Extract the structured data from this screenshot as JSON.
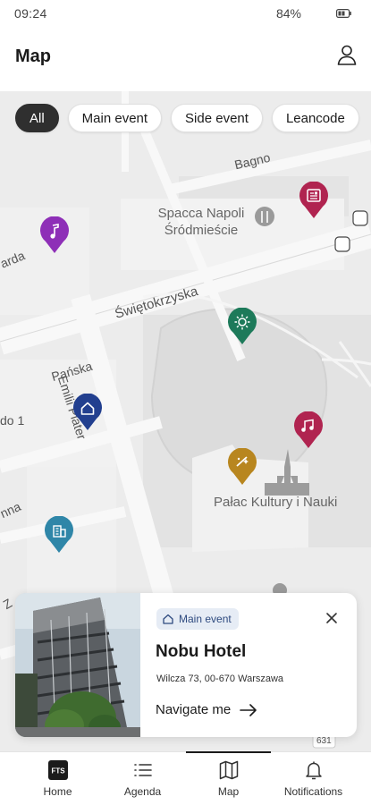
{
  "status_bar": {
    "time": "09:24",
    "battery": "84%"
  },
  "header": {
    "title": "Map"
  },
  "filters": [
    {
      "label": "All",
      "active": true
    },
    {
      "label": "Main event",
      "active": false
    },
    {
      "label": "Side event",
      "active": false
    },
    {
      "label": "Leancode",
      "active": false
    }
  ],
  "map": {
    "streets": {
      "bagno": "Bagno",
      "swietokrzyska": "Świętokrzyska",
      "emilii_plater": "Emilii Plater",
      "panska": "Pańska",
      "warda": "arda",
      "do1": "do 1",
      "nna": "nna",
      "za": "Z",
      "road_631": "631"
    },
    "pois": {
      "spacca": "Spacca Napoli\nŚródmieście",
      "palac": "Pałac Kultury i Nauki"
    },
    "markers": [
      {
        "name": "music",
        "color": "#8e2fb7"
      },
      {
        "name": "news",
        "color": "#b02450"
      },
      {
        "name": "sun",
        "color": "#1d7a5a"
      },
      {
        "name": "home",
        "color": "#223f8f"
      },
      {
        "name": "music",
        "color": "#b02450"
      },
      {
        "name": "sparkle",
        "color": "#b8861f"
      },
      {
        "name": "building",
        "color": "#2f86a8"
      }
    ]
  },
  "card": {
    "badge": "Main event",
    "title": "Nobu Hotel",
    "address": "Wilcza 73, 00-670 Warszawa",
    "navigate": "Navigate me"
  },
  "nav": {
    "items": [
      {
        "label": "Home",
        "icon": "fts-logo-icon"
      },
      {
        "label": "Agenda",
        "icon": "list-icon"
      },
      {
        "label": "Map",
        "icon": "map-icon"
      },
      {
        "label": "Notifications",
        "icon": "bell-icon"
      }
    ],
    "active": "Map"
  }
}
